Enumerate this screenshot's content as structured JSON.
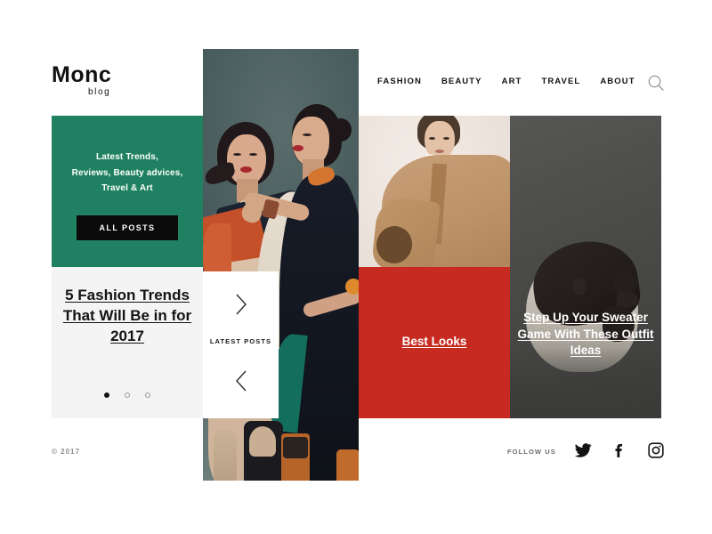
{
  "brand": {
    "name": "Monc",
    "tagline": "blog"
  },
  "nav": {
    "items": [
      {
        "label": "FASHION"
      },
      {
        "label": "BEAUTY"
      },
      {
        "label": "ART"
      },
      {
        "label": "TRAVEL"
      },
      {
        "label": "ABOUT"
      }
    ],
    "search_icon": "search-icon"
  },
  "promo": {
    "headline": "Latest Trends,\nReviews, Beauty advices,\nTravel & Art",
    "button_label": "ALL POSTS",
    "background_color": "#1f8162",
    "button_color": "#0b0b0b"
  },
  "carousel": {
    "title": "5 Fashion Trends That Will Be in for 2017",
    "dots": 3,
    "active_dot": 0,
    "background_color": "#f4f4f4"
  },
  "latest_posts": {
    "label": "LATEST POSTS",
    "next_icon": "chevron-right-icon",
    "prev_icon": "chevron-left-icon"
  },
  "cards": {
    "best_looks": {
      "title": "Best Looks",
      "background_color": "#c72a21"
    },
    "sweater": {
      "title": "Step Up Your Sweater Game With These Outfit Ideas",
      "background_color": "#4a4a49"
    }
  },
  "footer": {
    "copyright": "© 2017",
    "follow_label": "FOLLOW US",
    "social": [
      {
        "name": "twitter-icon"
      },
      {
        "name": "facebook-icon"
      },
      {
        "name": "instagram-icon"
      }
    ]
  }
}
